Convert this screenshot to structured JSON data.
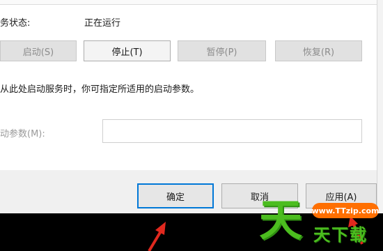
{
  "service": {
    "status_label": "务状态:",
    "status_value": "正在运行",
    "buttons": {
      "start": "启动(S)",
      "stop": "停止(T)",
      "pause": "暂停(P)",
      "resume": "恢复(R)"
    },
    "hint": "从此处启动服务时，你可指定所适用的启动参数。",
    "param_label": "动参数(M):",
    "param_value": ""
  },
  "footer": {
    "ok": "确定",
    "cancel": "取消",
    "apply": "应用(A)"
  },
  "watermark": {
    "logo_char": "天",
    "url": "www.TTzip.com",
    "name": "天下载"
  },
  "colors": {
    "accent": "#0078d7",
    "watermark_green": "#4cbd1f",
    "watermark_orange": "#ff6f00",
    "arrow_red": "#e0281e"
  }
}
